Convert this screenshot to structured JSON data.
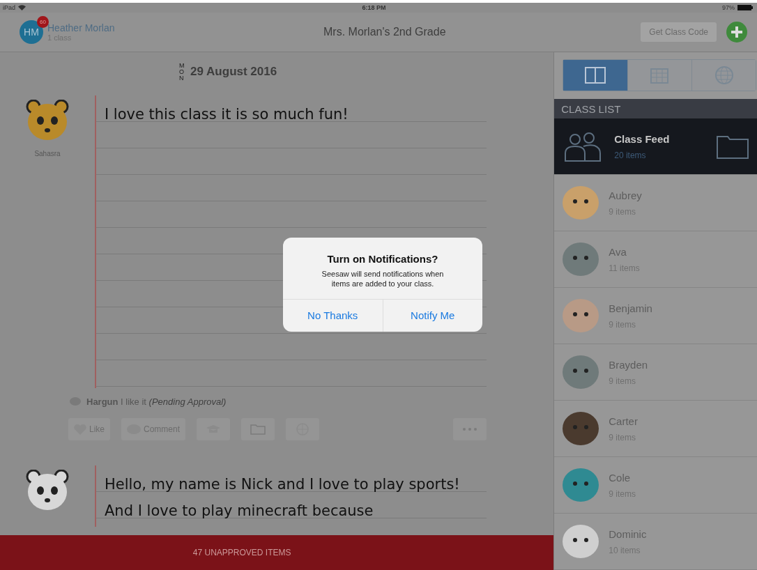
{
  "status_bar": {
    "device": "iPad",
    "time": "6:18 PM",
    "battery": "97%"
  },
  "header": {
    "avatar_initials": "HM",
    "badge": "60",
    "user_name": "Heather Morlan",
    "user_sub": "1 class",
    "class_title": "Mrs. Morlan's 2nd Grade",
    "class_code_button": "Get Class Code"
  },
  "feed": {
    "day": "MON",
    "date": "29 August 2016",
    "posts": [
      {
        "author": "Sahasra",
        "kind": "tiger",
        "text": "I love this class it is so much fun!",
        "comment": {
          "author": "Hargun",
          "text": "I like it",
          "status": "(Pending Approval)"
        },
        "actions": {
          "like": "Like",
          "comment": "Comment"
        }
      },
      {
        "kind": "panda",
        "text": "Hello, my name is Nick and I love to play sports! And I love to play minecraft because"
      }
    ]
  },
  "unapproved_bar": "47 UNAPPROVED ITEMS",
  "view_tabs": [
    {
      "kind": "journal",
      "selected": true
    },
    {
      "kind": "calendar",
      "selected": false
    },
    {
      "kind": "globe",
      "selected": false
    }
  ],
  "class_list": {
    "heading": "CLASS LIST",
    "items": [
      {
        "kind": "feed",
        "name": "Class Feed",
        "count": "20 items",
        "selected": true
      },
      {
        "kind": "student",
        "name": "Aubrey",
        "count": "9 items",
        "selected": false,
        "color": "#c9a06a"
      },
      {
        "kind": "student",
        "name": "Ava",
        "count": "11 items",
        "selected": false,
        "color": "#6f7a7a"
      },
      {
        "kind": "student",
        "name": "Benjamin",
        "count": "9 items",
        "selected": false,
        "color": "#b89a86"
      },
      {
        "kind": "student",
        "name": "Brayden",
        "count": "9 items",
        "selected": false,
        "color": "#6f7a7a"
      },
      {
        "kind": "student",
        "name": "Carter",
        "count": "9 items",
        "selected": false,
        "color": "#4a3a2e"
      },
      {
        "kind": "student",
        "name": "Cole",
        "count": "9 items",
        "selected": false,
        "color": "#2f8a92"
      },
      {
        "kind": "student",
        "name": "Dominic",
        "count": "10 items",
        "selected": false,
        "color": "#cfcfcf"
      }
    ]
  },
  "dialog": {
    "title": "Turn on Notifications?",
    "message": "Seesaw will send notifications when items are added to your class.",
    "buttons": [
      "No Thanks",
      "Notify Me"
    ]
  }
}
